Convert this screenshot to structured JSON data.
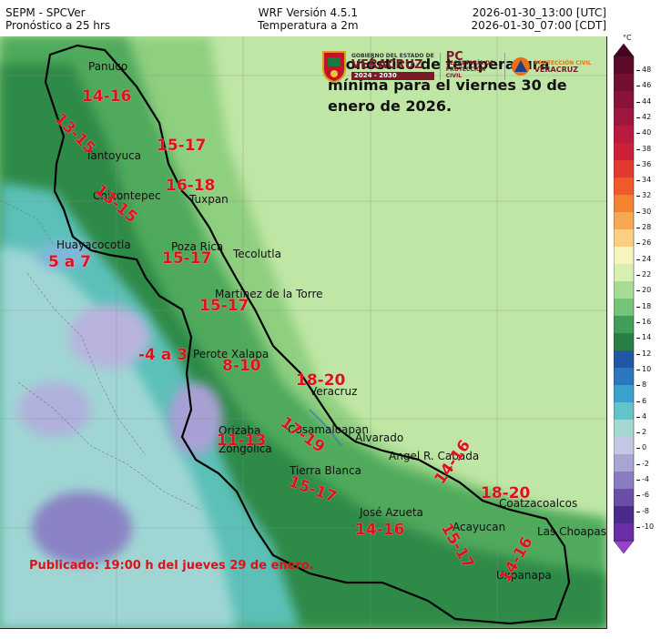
{
  "header": {
    "left_line1": "SEPM - SPCVer",
    "left_line2": "Pronóstico a 25 hrs",
    "center_line1": "WRF Versión 4.5.1",
    "center_line2": "Temperatura a 2m",
    "right_line1": "2026-01-30_13:00 [UTC]",
    "right_line2": "2026-01-30_07:00 [CDT]"
  },
  "forecast_title": "Pronóstico de temperatura mínima para el viernes 30 de enero de 2026.",
  "published": "Publicado: 19:00 h del jueves 29 de enero.",
  "logos": {
    "gov_small": "GOBIERNO DEL ESTADO DE",
    "gov_big": "VERACRUZ",
    "gov_years": "2024 - 2030",
    "pc_big": "PC",
    "pc_small": "SECRETARÍA DE PROTECCIÓN CIVIL",
    "pcv_small": "PROTECCIÓN CIVIL",
    "pcv_big": "VERACRUZ",
    "colors": {
      "brand": "#7a1b2b",
      "orange": "#e8701a"
    }
  },
  "places": [
    {
      "id": "panuco",
      "label": "Panuco"
    },
    {
      "id": "tantoyuca",
      "label": "Tantoyuca"
    },
    {
      "id": "chicontepec",
      "label": "Chicontepec"
    },
    {
      "id": "tuxpan",
      "label": "Tuxpan"
    },
    {
      "id": "huayacocotla",
      "label": "Huayacocotla"
    },
    {
      "id": "poza-rica",
      "label": "Poza Rica"
    },
    {
      "id": "tecolutla",
      "label": "Tecolutla"
    },
    {
      "id": "martinez",
      "label": "Martinez de la Torre"
    },
    {
      "id": "perote",
      "label": "Perote"
    },
    {
      "id": "xalapa",
      "label": "Xalapa"
    },
    {
      "id": "veracruz",
      "label": "Veracruz"
    },
    {
      "id": "orizaba",
      "label": "Orizaba"
    },
    {
      "id": "cosamaloapan",
      "label": "Cosamaloapan"
    },
    {
      "id": "zongolica",
      "label": "Zongolica"
    },
    {
      "id": "alvarado",
      "label": "Alvarado"
    },
    {
      "id": "cabada",
      "label": "Angel R. Cabada"
    },
    {
      "id": "tierra-blanca",
      "label": "Tierra Blanca"
    },
    {
      "id": "coatzacoalcos",
      "label": "Coatzacoalcos"
    },
    {
      "id": "jose-azueta",
      "label": "José Azueta"
    },
    {
      "id": "acayucan",
      "label": "Acayucan"
    },
    {
      "id": "las-choapas",
      "label": "Las Choapas"
    },
    {
      "id": "uxpanapa",
      "label": "Uxpanapa"
    }
  ],
  "temperature_ranges": [
    {
      "id": "panuco",
      "label": "14-16"
    },
    {
      "id": "tantoyuca-north",
      "label": "13-15"
    },
    {
      "id": "tuxpan-north",
      "label": "15-17"
    },
    {
      "id": "tuxpan",
      "label": "16-18"
    },
    {
      "id": "chicontepec",
      "label": "13-15"
    },
    {
      "id": "huayacocotla",
      "label": "5 a 7"
    },
    {
      "id": "poza-rica",
      "label": "15-17"
    },
    {
      "id": "martinez",
      "label": "15-17"
    },
    {
      "id": "perote",
      "label": "-4 a 3"
    },
    {
      "id": "xalapa",
      "label": "8-10"
    },
    {
      "id": "veracruz",
      "label": "18-20"
    },
    {
      "id": "orizaba",
      "label": "11-13"
    },
    {
      "id": "cosamaloapan",
      "label": "17-19"
    },
    {
      "id": "tierra-blanca",
      "label": "15-17"
    },
    {
      "id": "cabada",
      "label": "14-16"
    },
    {
      "id": "coatzacoalcos",
      "label": "18-20"
    },
    {
      "id": "jose-azueta",
      "label": "14-16"
    },
    {
      "id": "acayucan",
      "label": "15-17"
    },
    {
      "id": "las-choapas",
      "label": "14-16"
    }
  ],
  "colorbar": {
    "unit": "°C",
    "ticks": [
      48,
      46,
      44,
      42,
      40,
      38,
      36,
      34,
      32,
      30,
      28,
      26,
      24,
      22,
      20,
      18,
      16,
      14,
      12,
      10,
      8,
      6,
      4,
      2,
      0,
      -2,
      -4,
      -6,
      -8,
      -10
    ],
    "colors": [
      "#4a0020",
      "#5e0a2a",
      "#740f33",
      "#8a1238",
      "#a0163e",
      "#b81a40",
      "#cc2038",
      "#e03a30",
      "#f05a2a",
      "#f5822c",
      "#f8a850",
      "#fbcf80",
      "#f8f4c0",
      "#d7efb0",
      "#a8dc94",
      "#74c47a",
      "#3f9e58",
      "#2a7f44",
      "#2256a8",
      "#2a78c0",
      "#3aa0cc",
      "#62c4c8",
      "#a4d8d0",
      "#c4c8e4",
      "#a8a4d4",
      "#8a7cc0",
      "#6a4ea8",
      "#4a2a8c",
      "#6a2ea8",
      "#9a40d0"
    ]
  }
}
